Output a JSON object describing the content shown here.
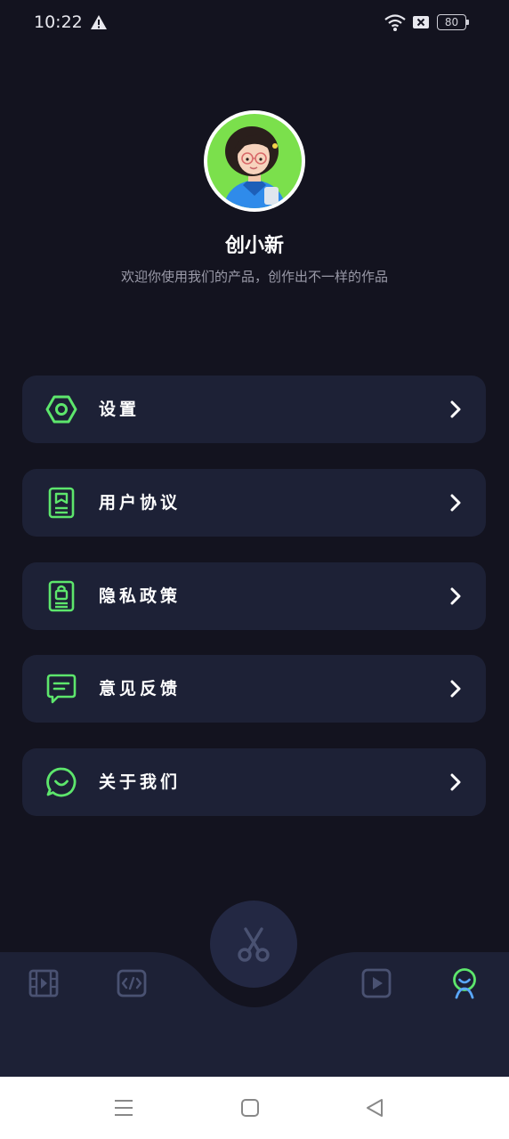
{
  "status_bar": {
    "time": "10:22",
    "battery": "80"
  },
  "profile": {
    "name": "创小新",
    "subtitle": "欢迎你使用我们的产品，创作出不一样的作品"
  },
  "menu": [
    {
      "label": "设置",
      "icon": "hexagon-settings-icon"
    },
    {
      "label": "用户协议",
      "icon": "user-agreement-icon"
    },
    {
      "label": "隐私政策",
      "icon": "privacy-lock-icon"
    },
    {
      "label": "意见反馈",
      "icon": "feedback-message-icon"
    },
    {
      "label": "关于我们",
      "icon": "chat-bubble-icon"
    }
  ],
  "tabs": [
    {
      "icon": "film-icon",
      "active": false
    },
    {
      "icon": "code-icon",
      "active": false
    },
    {
      "icon": "scissors-icon",
      "active": false
    },
    {
      "icon": "play-icon",
      "active": false
    },
    {
      "icon": "profile-icon",
      "active": true
    }
  ],
  "colors": {
    "background": "#13131f",
    "card": "#1d2136",
    "accent_green": "#5de66c",
    "accent_blue": "#5aa8ff",
    "icon_muted": "#4a5272",
    "avatar_bg": "#7be04c"
  }
}
